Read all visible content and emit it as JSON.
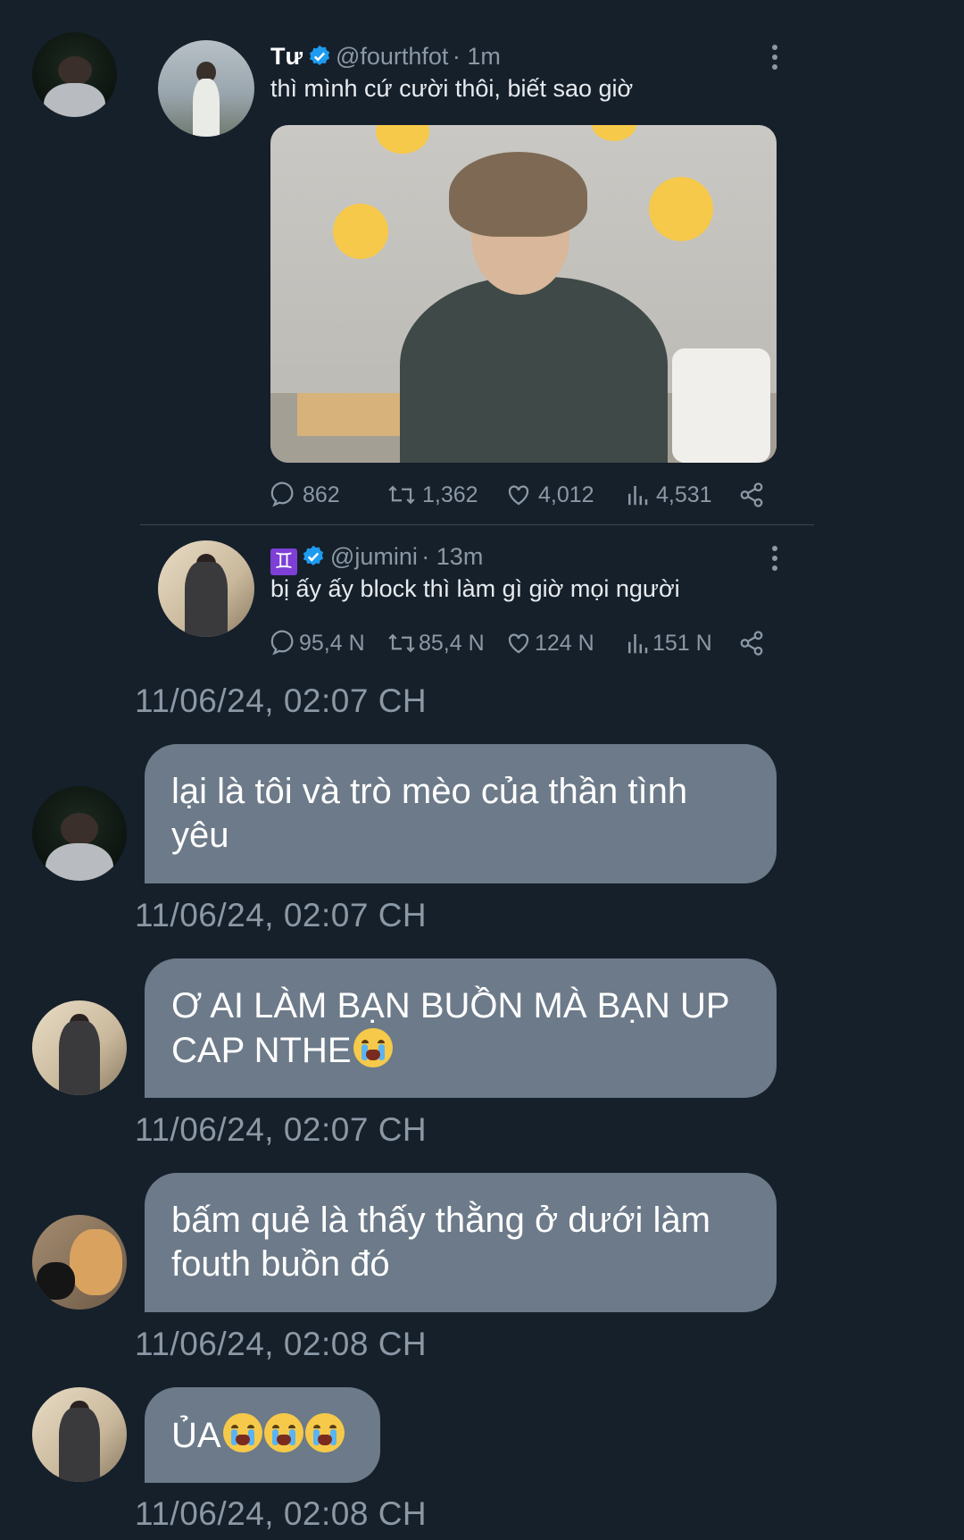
{
  "thread": {
    "sender_avatar_icon": "user-avatar-icon",
    "quoted_tweet": {
      "name": "Tư",
      "handle": "@fourthfot",
      "time": "· 1m",
      "text": "thì mình cứ cười thôi, biết sao giờ",
      "stats": {
        "replies": "862",
        "retweets": "1,362",
        "likes": "4,012",
        "views": "4,531"
      }
    },
    "reply_tweet": {
      "name_icon": "♊",
      "handle": "@jumini",
      "time": "· 13m",
      "text": "bị ấy ấy block thì làm gì giờ mọi người",
      "stats": {
        "replies": "95,4 N",
        "retweets": "85,4 N",
        "likes": "124 N",
        "views": "151 N"
      }
    },
    "first_timestamp": "11/06/24, 02:07 CH"
  },
  "messages": [
    {
      "text": "lại là tôi và trò mèo của thần tình yêu",
      "line1": "lại là tôi và trò mèo của thần tình",
      "line2": "yêu",
      "timestamp": "11/06/24, 02:07 CH"
    },
    {
      "text": "Ơ AI LÀM BẠN BUỒN MÀ BẠN UP CAP NTHE😭",
      "line1": "Ơ AI LÀM BẠN BUỒN MÀ BẠN UP",
      "line2": "CAP NTHE",
      "timestamp": "11/06/24, 02:07 CH"
    },
    {
      "text": "bấm quẻ là thấy thằng ở dưới làm fouth buồn đó",
      "line1": "bấm quẻ là thấy thằng ở dưới làm",
      "line2": "fouth buồn đó",
      "timestamp": "11/06/24, 02:08 CH"
    },
    {
      "text": "ỦA😭😭😭",
      "line1": "ỦA",
      "timestamp": "11/06/24, 02:08 CH"
    }
  ],
  "colors": {
    "background": "#16202b",
    "bubble": "#6c7a89",
    "muted": "#8b98a5",
    "verified": "#1d9bf0"
  }
}
